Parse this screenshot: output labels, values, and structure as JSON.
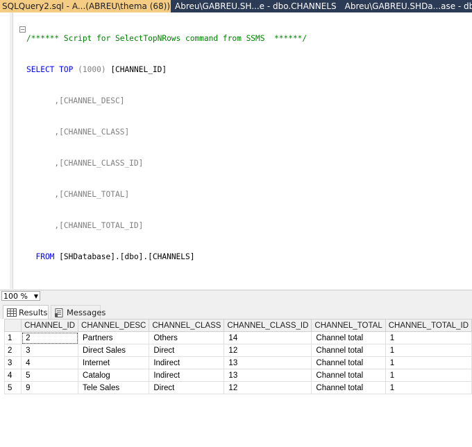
{
  "tabs": [
    {
      "title": "SQLQuery2.sql - A...(ABREU\\thema (68))",
      "pin": "⊕",
      "close": "✕"
    },
    {
      "title": "Abreu\\GABREU.SH...e - dbo.CHANNELS"
    },
    {
      "title": "Abreu\\GABREU.SHDa...ase - dbo.Tab"
    }
  ],
  "code": {
    "comment": "/****** Script for SelectTopNRows command from SSMS  ******/",
    "select_kw": "SELECT",
    "top_kw": "TOP",
    "top_value": "(1000)",
    "col1": "[CHANNEL_ID]",
    "cols": [
      "      ,[CHANNEL_DESC]",
      "      ,[CHANNEL_CLASS]",
      "      ,[CHANNEL_CLASS_ID]",
      "      ,[CHANNEL_TOTAL]",
      "      ,[CHANNEL_TOTAL_ID]"
    ],
    "from_kw": "  FROM",
    "from_target": "[SHDatabase].[dbo].[CHANNELS]"
  },
  "zoom": "100 %",
  "result_tabs": {
    "results": "Results",
    "messages": "Messages"
  },
  "grid": {
    "headers": [
      "CHANNEL_ID",
      "CHANNEL_DESC",
      "CHANNEL_CLASS",
      "CHANNEL_CLASS_ID",
      "CHANNEL_TOTAL",
      "CHANNEL_TOTAL_ID"
    ],
    "rows": [
      {
        "n": "1",
        "cells": [
          "2",
          "Partners",
          "Others",
          "14",
          "Channel total",
          "1"
        ]
      },
      {
        "n": "2",
        "cells": [
          "3",
          "Direct Sales",
          "Direct",
          "12",
          "Channel total",
          "1"
        ]
      },
      {
        "n": "3",
        "cells": [
          "4",
          "Internet",
          "Indirect",
          "13",
          "Channel total",
          "1"
        ]
      },
      {
        "n": "4",
        "cells": [
          "5",
          "Catalog",
          "Indirect",
          "13",
          "Channel total",
          "1"
        ]
      },
      {
        "n": "5",
        "cells": [
          "9",
          "Tele Sales",
          "Direct",
          "12",
          "Channel total",
          "1"
        ]
      }
    ]
  }
}
